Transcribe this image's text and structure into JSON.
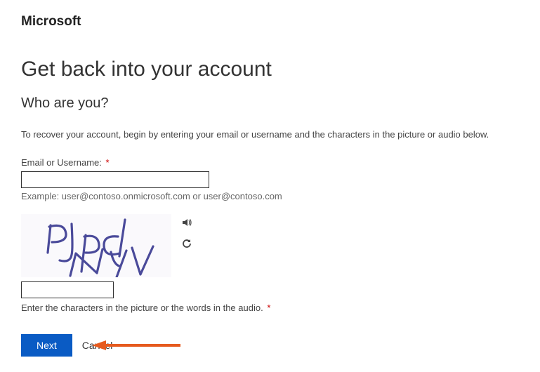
{
  "brand": "Microsoft",
  "page_title": "Get back into your account",
  "subtitle": "Who are you?",
  "instructions": "To recover your account, begin by entering your email or username and the characters in the picture or audio below.",
  "email": {
    "label": "Email or Username:",
    "value": "",
    "hint": "Example: user@contoso.onmicrosoft.com or user@contoso.com"
  },
  "captcha": {
    "image_text": "PJpd NyV",
    "input_value": "",
    "hint": "Enter the characters in the picture or the words in the audio."
  },
  "buttons": {
    "next": "Next",
    "cancel": "Cancel"
  },
  "colors": {
    "primary": "#0a5bc4",
    "annotation": "#e65a1e"
  }
}
